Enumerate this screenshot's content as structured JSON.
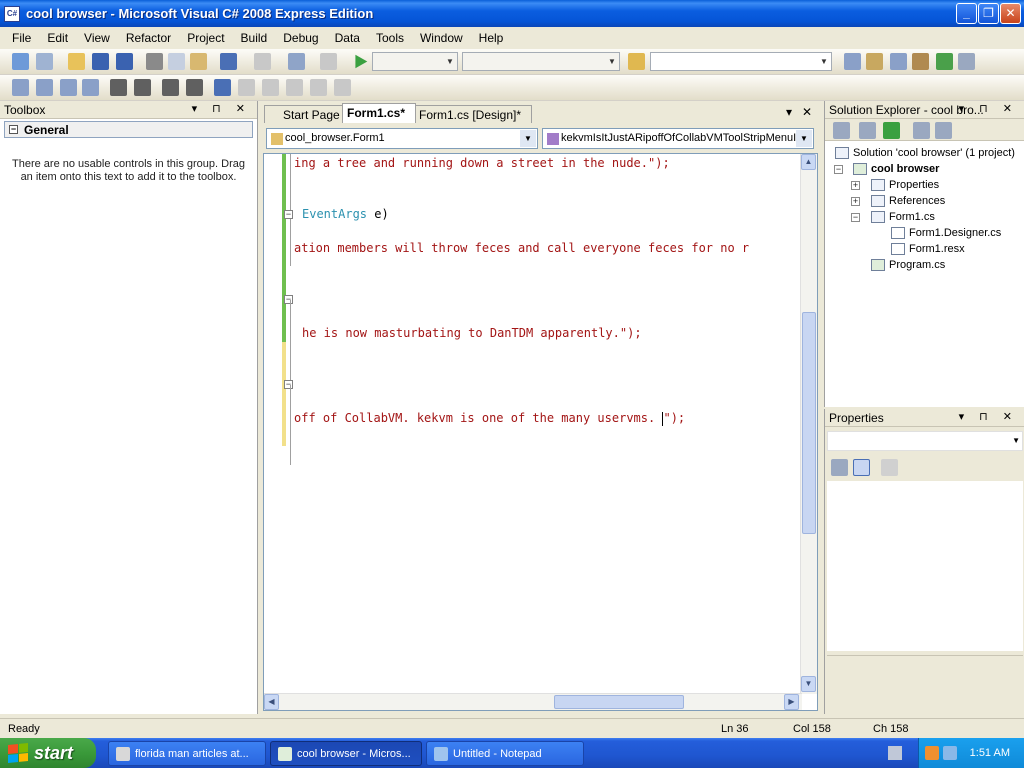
{
  "window": {
    "title": "cool browser - Microsoft Visual C# 2008 Express Edition",
    "app_icon_text": "C#",
    "minimize": "_",
    "maximize": "❐",
    "close": "✕"
  },
  "menu": [
    "File",
    "Edit",
    "View",
    "Refactor",
    "Project",
    "Build",
    "Debug",
    "Data",
    "Tools",
    "Window",
    "Help"
  ],
  "toolbox": {
    "title": "Toolbox",
    "header_buttons": "▾ ⊓ ✕",
    "group": "General",
    "empty_message": "There are no usable controls in this group. Drag an item onto this text to add it to the toolbox."
  },
  "tabs": [
    {
      "label": "Start Page",
      "active": false
    },
    {
      "label": "Form1.cs*",
      "active": true
    },
    {
      "label": "Form1.cs [Design]*",
      "active": false
    }
  ],
  "tab_controls": {
    "dropdown": "▾",
    "close": "✕"
  },
  "nav": {
    "class_combo": "cool_browser.Form1",
    "member_combo": "kekvmIsItJustARipoffOfCollabVMToolStripMenuIt"
  },
  "code_lines": [
    {
      "text": "ing a tree and running down a street in the nude.\");"
    },
    {
      "type_text": "EventArgs",
      "rest": " e)"
    },
    {
      "text": "ation members will throw feces and call everyone feces for no r"
    },
    {
      "text": "he is now masturbating to DanTDM apparently.\");"
    },
    {
      "text_before_caret": "off of CollabVM. kekvm is one of the many uservms. ",
      "text_after_caret": "\");"
    }
  ],
  "solution_explorer": {
    "title": "Solution Explorer - cool bro...",
    "header_buttons": "▾ ⊓ ✕",
    "tree": [
      {
        "label": "Solution 'cool browser' (1 project)",
        "bold": false
      },
      {
        "label": "cool browser",
        "bold": true
      },
      {
        "label": "Properties",
        "bold": false
      },
      {
        "label": "References",
        "bold": false
      },
      {
        "label": "Form1.cs",
        "bold": false
      },
      {
        "label": "Form1.Designer.cs",
        "bold": false
      },
      {
        "label": "Form1.resx",
        "bold": false
      },
      {
        "label": "Program.cs",
        "bold": false
      }
    ]
  },
  "properties": {
    "title": "Properties",
    "header_buttons": "▾ ⊓ ✕"
  },
  "status": {
    "state": "Ready",
    "ln": "Ln 36",
    "col": "Col 158",
    "ch": "Ch 158"
  },
  "taskbar": {
    "start": "start",
    "tasks": [
      {
        "label": "florida man articles at...",
        "active": false
      },
      {
        "label": "cool browser - Micros...",
        "active": true
      },
      {
        "label": "Untitled - Notepad",
        "active": false
      }
    ],
    "clock": "1:51 AM"
  },
  "colors": {
    "titlebar": "#0554d6",
    "string": "#a31515",
    "type": "#2b91af",
    "change_bar_saved": "#6fbf4f",
    "change_bar_unsaved": "#f2e08a"
  }
}
